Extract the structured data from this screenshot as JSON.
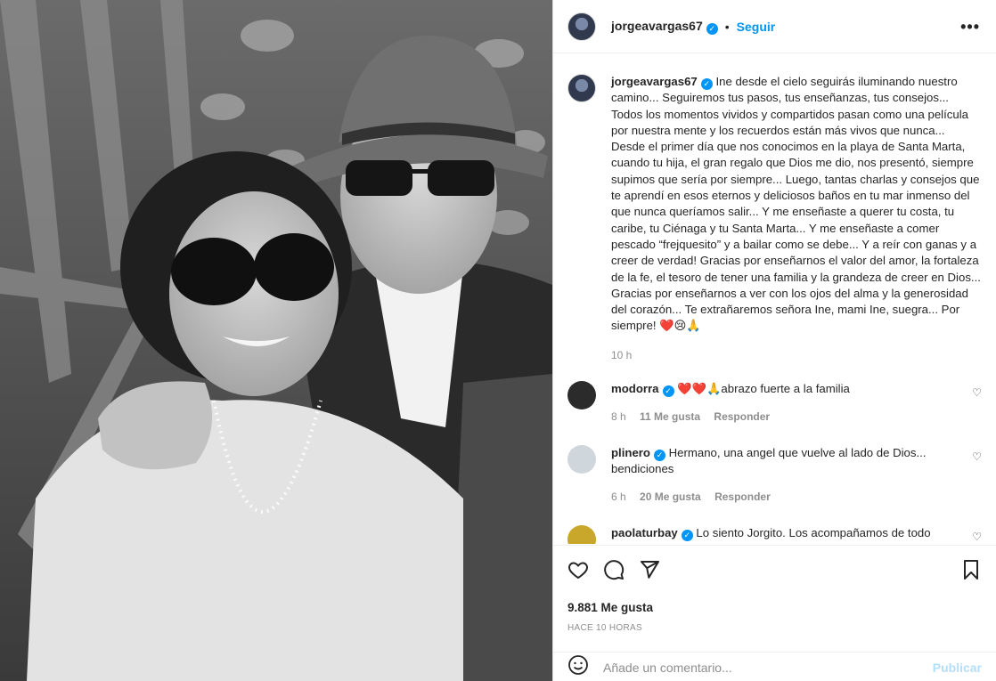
{
  "post": {
    "username": "jorgeavargas67",
    "follow_label": "Seguir",
    "more_label": "•••",
    "dot": "•",
    "photo_alt": "Foto en blanco y negro de una mujer con gafas de sol y un hombre con sombrero"
  },
  "caption": {
    "username": "jorgeavargas67",
    "text": " Ine desde el cielo seguirás iluminando nuestro camino... Seguiremos tus pasos, tus enseñanzas, tus consejos... Todos los momentos vividos y compartidos pasan como una película por nuestra mente y los recuerdos están más vivos que nunca... Desde el primer día que nos conocimos en la playa de Santa Marta, cuando tu hija, el gran regalo que Dios me dio, nos presentó, siempre supimos que sería por siempre... Luego, tantas charlas y consejos que te aprendí en esos eternos y deliciosos baños en tu mar inmenso del que nunca queríamos salir... Y me enseñaste a querer tu costa, tu caribe, tu Ciénaga y tu Santa Marta... Y me enseñaste a comer pescado “frejquesito” y a bailar como se debe... Y a reír con ganas y a creer de verdad! Gracias por enseñarnos el valor del amor, la fortaleza de la fe, el tesoro de tener una familia y la grandeza de creer en Dios... Gracias por enseñarnos a ver con los ojos del alma y la generosidad del corazón... Te extrañaremos señora Ine, mami Ine, suegra... Por siempre! ❤️😢🙏",
    "time": "10 h"
  },
  "comments": [
    {
      "username": "modorra",
      "text": " ❤️❤️🙏abrazo fuerte a la familia",
      "time": "8 h",
      "likes": "11 Me gusta",
      "reply": "Responder",
      "avatar_color": "#2b2b2b"
    },
    {
      "username": "plinero",
      "text": " Hermano, una angel que vuelve al lado de Dios... bendiciones",
      "time": "6 h",
      "likes": "20 Me gusta",
      "reply": "Responder",
      "avatar_color": "#cfd6dc"
    },
    {
      "username": "paolaturbay",
      "text": " Lo siento Jorgito. Los acompañamos de todo",
      "time": "",
      "likes": "",
      "reply": "",
      "avatar_color": "#c9a72a"
    }
  ],
  "footer": {
    "likes_count": "9.881 Me gusta",
    "post_time": "HACE 10 HORAS",
    "comment_placeholder": "Añade un comentario...",
    "publish_label": "Publicar"
  },
  "verified_mark": "✓",
  "comment_like": "♡"
}
